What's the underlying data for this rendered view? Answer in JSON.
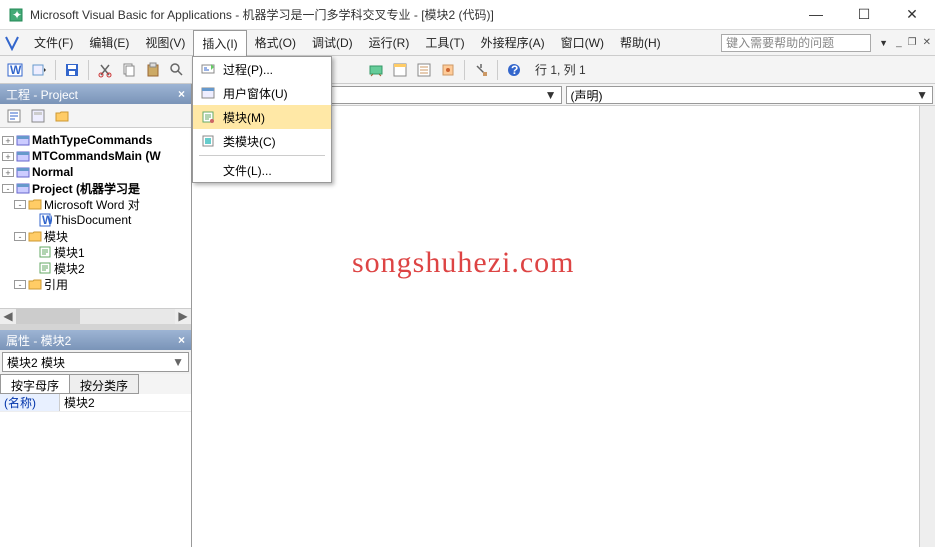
{
  "title": "Microsoft Visual Basic for Applications - 机器学习是一门多学科交叉专业 - [模块2 (代码)]",
  "menubar": {
    "items": [
      {
        "label": "文件(F)"
      },
      {
        "label": "编辑(E)"
      },
      {
        "label": "视图(V)"
      },
      {
        "label": "插入(I)"
      },
      {
        "label": "格式(O)"
      },
      {
        "label": "调试(D)"
      },
      {
        "label": "运行(R)"
      },
      {
        "label": "工具(T)"
      },
      {
        "label": "外接程序(A)"
      },
      {
        "label": "窗口(W)"
      },
      {
        "label": "帮助(H)"
      }
    ],
    "help_placeholder": "键入需要帮助的问题"
  },
  "insert_menu": {
    "items": [
      {
        "label": "过程(P)...",
        "icon": "procedure-icon"
      },
      {
        "label": "用户窗体(U)",
        "icon": "userform-icon"
      },
      {
        "label": "模块(M)",
        "icon": "module-icon",
        "highlight": true
      },
      {
        "label": "类模块(C)",
        "icon": "classmodule-icon"
      },
      {
        "label": "文件(L)...",
        "icon": null
      }
    ]
  },
  "toolbar": {
    "cursor_pos": "行 1, 列 1"
  },
  "project_panel": {
    "title": "工程 - Project",
    "tree": [
      {
        "indent": 0,
        "exp": "+",
        "icon": "proj",
        "label": "MathTypeCommands",
        "bold": true
      },
      {
        "indent": 0,
        "exp": "+",
        "icon": "proj",
        "label": "MTCommandsMain (W",
        "bold": true
      },
      {
        "indent": 0,
        "exp": "+",
        "icon": "proj",
        "label": "Normal",
        "bold": true
      },
      {
        "indent": 0,
        "exp": "-",
        "icon": "proj",
        "label": "Project (机器学习是",
        "bold": true
      },
      {
        "indent": 1,
        "exp": "-",
        "icon": "folder",
        "label": "Microsoft Word 对",
        "bold": false
      },
      {
        "indent": 2,
        "exp": "",
        "icon": "doc",
        "label": "ThisDocument",
        "bold": false
      },
      {
        "indent": 1,
        "exp": "-",
        "icon": "folder",
        "label": "模块",
        "bold": false
      },
      {
        "indent": 2,
        "exp": "",
        "icon": "mod",
        "label": "模块1",
        "bold": false
      },
      {
        "indent": 2,
        "exp": "",
        "icon": "mod",
        "label": "模块2",
        "bold": false
      },
      {
        "indent": 1,
        "exp": "-",
        "icon": "folder",
        "label": "引用",
        "bold": false
      }
    ]
  },
  "properties_panel": {
    "title": "属性 - 模块2",
    "object": "模块2 模块",
    "tabs": [
      "按字母序",
      "按分类序"
    ],
    "rows": [
      {
        "name": "(名称)",
        "value": "模块2"
      }
    ]
  },
  "code_panel": {
    "left_dropdown": "",
    "right_dropdown": "(声明)"
  },
  "watermark": "songshuhezi.com"
}
